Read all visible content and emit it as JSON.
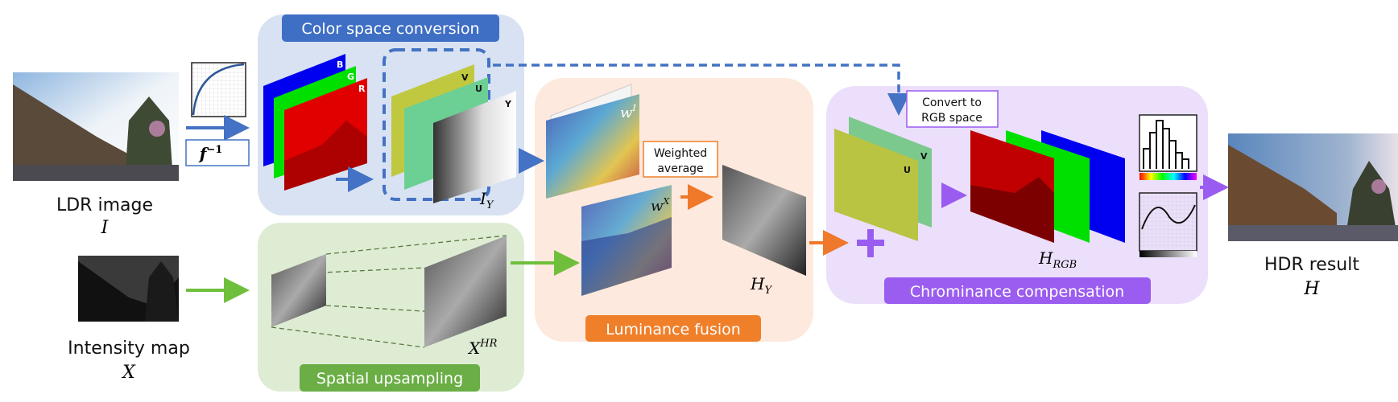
{
  "inputs": {
    "ldr": {
      "label": "LDR image",
      "symbol": "I"
    },
    "intensity": {
      "label": "Intensity map",
      "symbol": "X"
    }
  },
  "inverse_crf": {
    "label_base": "f",
    "label_sup": "−1"
  },
  "stages": {
    "color_space": {
      "title": "Color space conversion",
      "channels_rgb": [
        "B",
        "G",
        "R"
      ],
      "channels_yuv": [
        "V",
        "U",
        "Y"
      ],
      "output_base": "I",
      "output_sub": "Y",
      "color": "#3f6fc4",
      "bg": "#d8e2f2"
    },
    "spatial": {
      "title": "Spatial upsampling",
      "output_base": "X",
      "output_sup": "HR",
      "color": "#6aae45",
      "bg": "#deecd4"
    },
    "luminance": {
      "title": "Luminance fusion",
      "weight_i_base": "w",
      "weight_i_sup": "I",
      "weight_x_base": "w",
      "weight_x_sup": "X",
      "op_line1": "Weighted",
      "op_line2": "average",
      "output_base": "H",
      "output_sub": "Y",
      "color": "#f07f2a",
      "bg": "#fde9dd"
    },
    "chrominance": {
      "title": "Chrominance compensation",
      "convert_line1": "Convert to",
      "convert_line2": "RGB space",
      "channels_uv": [
        "V",
        "U"
      ],
      "output_base": "H",
      "output_sub": "RGB",
      "color": "#9b5cf0",
      "bg": "#ebdffb"
    }
  },
  "output": {
    "label": "HDR result",
    "symbol": "H"
  },
  "arrow_colors": {
    "blue": "#4472c4",
    "green": "#70bf3c",
    "orange": "#f0782a",
    "purple": "#9a5cf0"
  }
}
